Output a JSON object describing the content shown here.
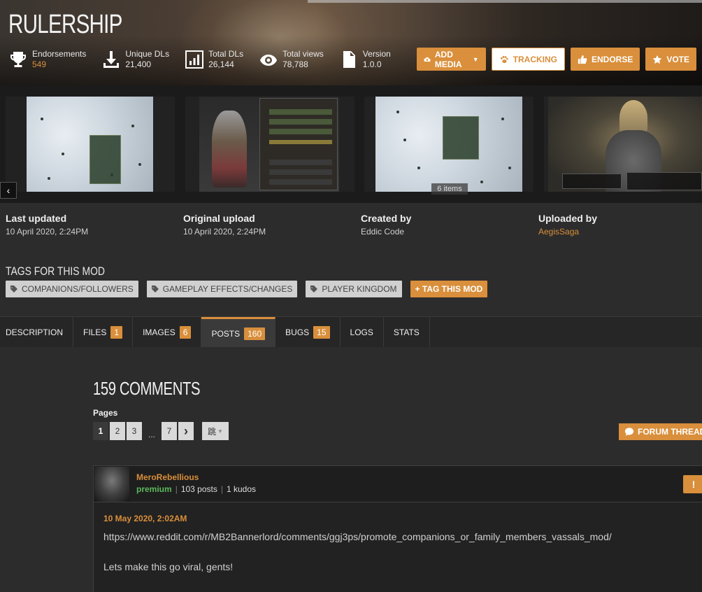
{
  "mod": {
    "title": "RULERSHIP",
    "stats": [
      {
        "label": "Endorsements",
        "value": "549",
        "icon": "trophy-icon"
      },
      {
        "label": "Unique DLs",
        "value": "21,400",
        "icon": "download-icon"
      },
      {
        "label": "Total DLs",
        "value": "26,144",
        "icon": "bar-chart-icon"
      },
      {
        "label": "Total views",
        "value": "78,788",
        "icon": "eye-icon"
      },
      {
        "label": "Version",
        "value": "1.0.0",
        "icon": "document-icon"
      }
    ],
    "actions": {
      "add_media": "ADD MEDIA",
      "tracking": "TRACKING",
      "endorse": "ENDORSE",
      "vote": "VOTE"
    }
  },
  "gallery": {
    "count_label": "6 items"
  },
  "meta": {
    "last_updated": {
      "label": "Last updated",
      "value": "10 April 2020,  2:24PM"
    },
    "original_upload": {
      "label": "Original upload",
      "value": "10 April 2020,  2:24PM"
    },
    "created_by": {
      "label": "Created by",
      "value": "Eddic Code"
    },
    "uploaded_by": {
      "label": "Uploaded by",
      "value": "AegisSaga"
    }
  },
  "tags": {
    "title": "TAGS FOR THIS MOD",
    "items": [
      "COMPANIONS/FOLLOWERS",
      "GAMEPLAY EFFECTS/CHANGES",
      "PLAYER KINGDOM"
    ],
    "add_label": "+ TAG THIS MOD"
  },
  "tabs": [
    {
      "label": "DESCRIPTION",
      "count": ""
    },
    {
      "label": "FILES",
      "count": "1"
    },
    {
      "label": "IMAGES",
      "count": "6"
    },
    {
      "label": "POSTS",
      "count": "160"
    },
    {
      "label": "BUGS",
      "count": "15"
    },
    {
      "label": "LOGS",
      "count": ""
    },
    {
      "label": "STATS",
      "count": ""
    }
  ],
  "comments": {
    "title": "159 COMMENTS",
    "pages_label": "Pages",
    "pages": [
      "1",
      "2",
      "3",
      "...",
      "7"
    ],
    "next": "›",
    "jump": "跳",
    "forum_label": "FORUM THREAD",
    "first": {
      "author": "MeroRebellious",
      "rank": "premium",
      "posts": "103 posts",
      "kudos": "1 kudos",
      "date": "10 May 2020, 2:02AM",
      "lines": [
        "https://www.reddit.com/r/MB2Bannerlord/comments/ggj3ps/promote_companions_or_family_members_vassals_mod/",
        "Lets make this go viral, gents!"
      ]
    }
  },
  "colors": {
    "accent": "#d98f3b",
    "premium": "#5cb85c",
    "background": "#2c2c2c"
  }
}
